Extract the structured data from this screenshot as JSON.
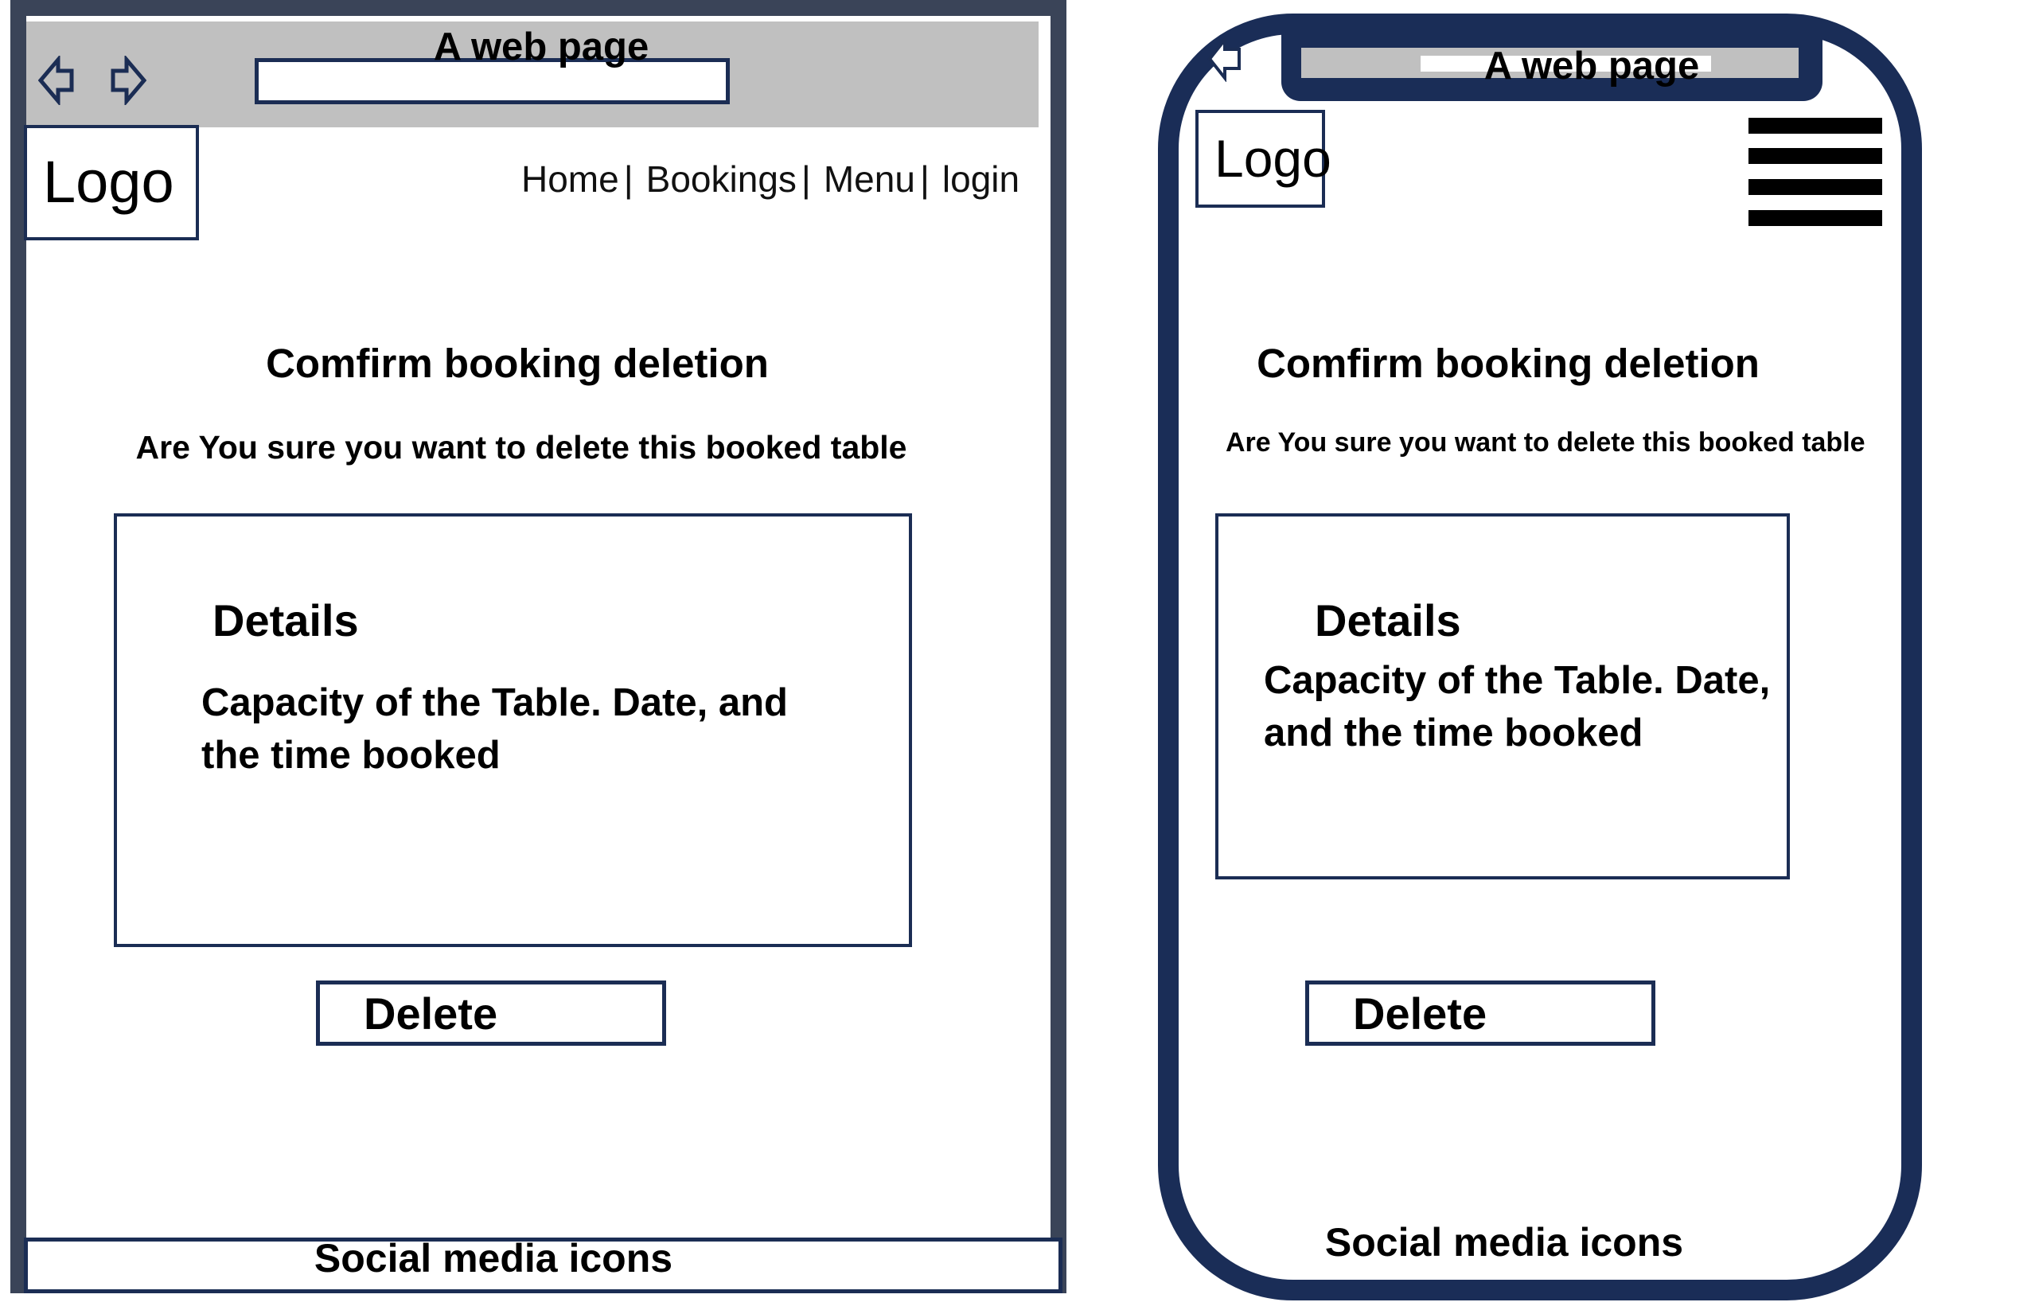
{
  "desktop": {
    "browser_title": "A web page",
    "logo": "Logo",
    "nav": [
      "Home",
      "Bookings",
      "Menu",
      "login"
    ],
    "nav_separator": "|",
    "heading": "Comfirm booking deletion",
    "question": "Are You sure you want to delete this booked table",
    "details_title": "Details",
    "details_text": "Capacity of the Table. Date, and the time booked",
    "delete_label": "Delete",
    "footer": "Social media icons"
  },
  "mobile": {
    "browser_title": "A web page",
    "logo": "Logo",
    "heading": "Comfirm booking deletion",
    "question": "Are You sure you want to delete this booked table",
    "details_title": "Details",
    "details_text": "Capacity of the Table. Date, and the time booked",
    "delete_label": "Delete",
    "footer": "Social media icons"
  },
  "icons": {
    "back": "back-arrow-icon",
    "forward": "forward-arrow-icon",
    "menu": "hamburger-menu-icon"
  },
  "colors": {
    "frame": "#3a4458",
    "outline": "#1b2d54",
    "phone_body": "#1a2d57",
    "toolbar": "#c0c0c0"
  }
}
